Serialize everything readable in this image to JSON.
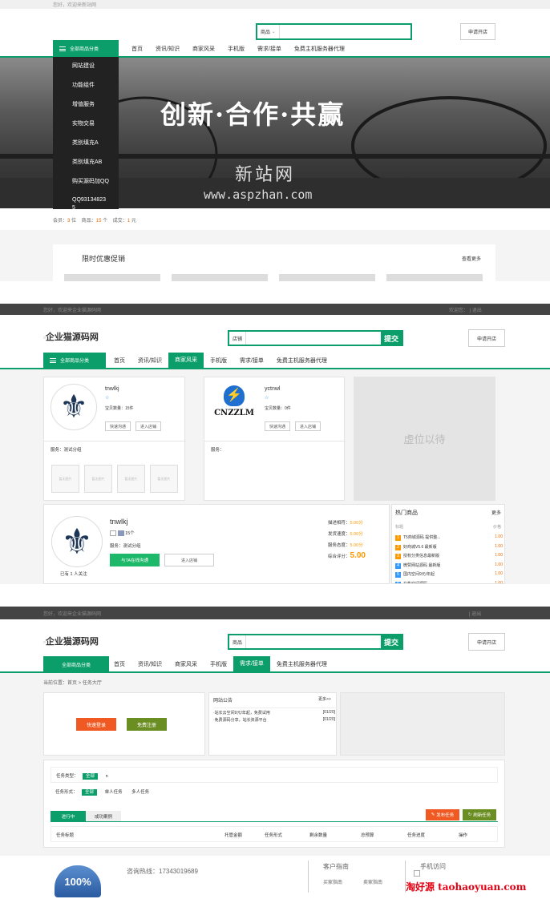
{
  "s1": {
    "welcome": "您好，欢迎来新站网",
    "search_select": "商品",
    "apply": "申请开店",
    "cat": "全部商品分类",
    "nav": [
      "首页",
      "资讯/知识",
      "商家风采",
      "手机版",
      "需求/接单",
      "免费主机服务器代理"
    ],
    "menu": [
      "网站建设",
      "功能组件",
      "增值服务",
      "实物交易",
      "类别填充A",
      "类别填充AB",
      "购买源码加QQ",
      "QQ93134823",
      "5"
    ],
    "slogan": "创新·合作·共赢",
    "watermark1": "新站网",
    "watermark2": "www.aspzhan.com",
    "stats": {
      "members_label": "会员：",
      "members_val": "3",
      "members_unit": "位",
      "goods_label": "商品：",
      "goods_val": "15",
      "goods_unit": "个",
      "deals_label": "成交：",
      "deals_val": "1",
      "deals_unit": "元"
    },
    "promo_title": "限时优惠促销",
    "promo_more": "查看更多"
  },
  "s2": {
    "topleft": "您好，欢迎来企业猫源码网",
    "topright_a": "欢迎您：",
    "topright_b": "| 退出",
    "logo_alt": "企业猫源码网",
    "search_select": "店铺",
    "search_btn": "提交",
    "apply": "申请开店",
    "cat": "全部商品分类",
    "nav": [
      "首页",
      "资讯/知识",
      "商家风采",
      "手机版",
      "需求/接单",
      "免费主机服务器代理"
    ],
    "shop1": {
      "name": "tnwlkj",
      "star": "☆",
      "count": "宝贝数量：15件",
      "btn1": "快速沟通",
      "btn2": "进入店铺",
      "service": "服务：测试分组",
      "img": "暂无图片"
    },
    "shop2": {
      "name": "yctnwl",
      "logo": "CNZZLM",
      "star": "☆",
      "count": "宝贝数量：0件",
      "btn1": "快速沟通",
      "btn2": "进入店铺",
      "service": "服务："
    },
    "placeholder": "虚位以待",
    "shop3": {
      "name": "tnwlkj",
      "count": "15个",
      "service": "服务：测试分组",
      "btn1": "与TA在线沟通",
      "btn2": "进入店铺",
      "fans": "已有 1 人关注",
      "r1l": "描述相符：",
      "r1v": "5.00分",
      "r2l": "发货速度：",
      "r2v": "5.00分",
      "r3l": "服务态度：",
      "r3v": "5.00分",
      "r4l": "综合评分：",
      "r4v": "5.00"
    },
    "hot": {
      "title": "热门商品",
      "more": "更多",
      "h1": "标题",
      "h2": "价格",
      "items": [
        {
          "n": "1",
          "t": "T5商城源码 提供整...",
          "p": "1.00"
        },
        {
          "n": "2",
          "t": "好商城V5.6 最新版",
          "p": "1.00"
        },
        {
          "n": "3",
          "t": "授权分类信息最新版",
          "p": "1.00"
        },
        {
          "n": "4",
          "t": "微赞网站源码 最新版",
          "p": "1.00"
        },
        {
          "n": "5",
          "t": "国内空间9元/年起",
          "p": "1.00"
        },
        {
          "n": "6",
          "t": "在售空间源码",
          "p": "1.00"
        }
      ]
    }
  },
  "s3": {
    "topleft": "您好，欢迎来企业猫源码网",
    "topright": "| 退出",
    "logo_alt": "企业猫源码网",
    "search_select": "商品",
    "search_btn": "提交",
    "apply": "申请开店",
    "cat": "全部商品分类",
    "nav": [
      "首页",
      "资讯/知识",
      "商家风采",
      "手机版",
      "需求/接单",
      "免费主机服务器代理"
    ],
    "breadcrumb": "当前位置：首页 > 任务大厅",
    "login": "快速登录",
    "register": "免费注册",
    "notice": {
      "title": "网站公告",
      "more": "更多>>",
      "items": [
        {
          "t": "·站长云空间9元/年起，免费试用",
          "d": "[01/20]"
        },
        {
          "t": "·免费源码分享，站长资源平台",
          "d": "[01/20]"
        }
      ]
    },
    "f1l": "任务类型：",
    "f1a": "全部",
    "f1b": "n",
    "f2l": "任务形式：",
    "f2a": "全部",
    "f2b": "单人任务",
    "f2c": "多人任务",
    "tab1": "进行中",
    "tab2": "成功案例",
    "publish": "发布任务",
    "refresh": "刷新任务",
    "cols": [
      "任务标题",
      "托管金额",
      "任务形式",
      "剩余数量",
      "总预算",
      "任务进度",
      "操作"
    ],
    "badge": "100%",
    "hotline": "咨询热线：17343019689",
    "guide": "客户指南",
    "guide1": "买家指南",
    "guide2": "卖家指南",
    "mobile": "手机访问",
    "footer_wm": "淘好源 taohaoyuan.com"
  }
}
